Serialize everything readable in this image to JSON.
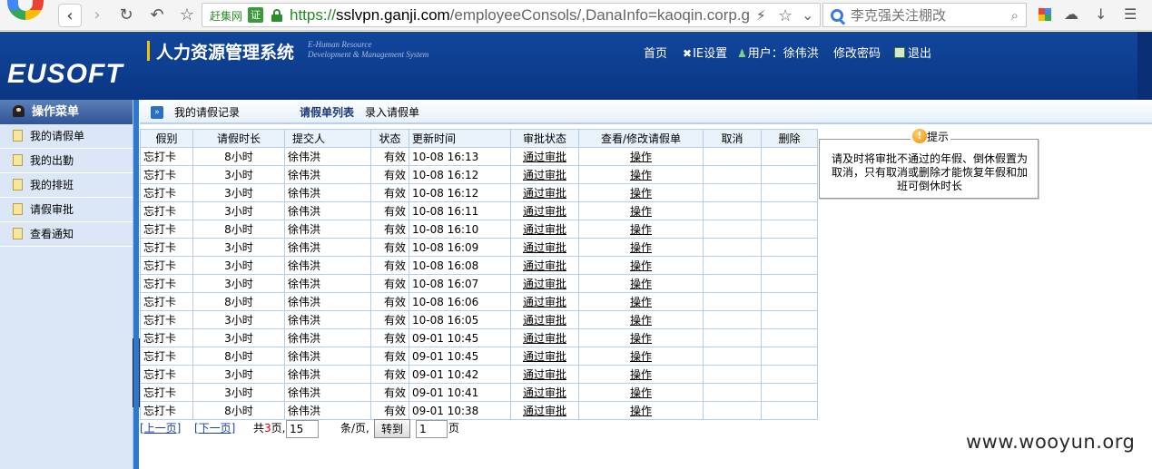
{
  "browser": {
    "site_tag": "赶集网",
    "cert_badge": "证",
    "url_scheme": "https://",
    "url_host": "sslvpn.ganji.com",
    "url_path": "/employeeConsols/,DanaInfo=kaoqin.corp.ga",
    "search_placeholder": "李克强关注棚改"
  },
  "header": {
    "logo": "EUSOFT",
    "title": "人力资源管理系统",
    "subtitle_line1": "E-Human Resource",
    "subtitle_line2": "Development & Management System",
    "nav": {
      "home": "首页",
      "ie_settings": "IE设置",
      "user_label": "用户：徐伟洪",
      "change_password": "修改密码",
      "logout": "退出"
    }
  },
  "sidebar": {
    "title": "操作菜单",
    "items": [
      {
        "label": "我的请假单"
      },
      {
        "label": "我的出勤"
      },
      {
        "label": "我的排班"
      },
      {
        "label": "请假审批"
      },
      {
        "label": "查看通知"
      }
    ]
  },
  "tabs": {
    "records": "我的请假记录",
    "list": "请假单列表",
    "enter": "录入请假单"
  },
  "table": {
    "headers": [
      "假别",
      "请假时长",
      "提交人",
      "状态",
      "更新时间",
      "审批状态",
      "查看/修改请假单",
      "取消",
      "删除"
    ],
    "rows": [
      {
        "type": "忘打卡",
        "duration": "8小时",
        "user": "徐伟洪",
        "state": "有效",
        "time": "10-08 16:13",
        "approval": "通过审批",
        "op": "操作"
      },
      {
        "type": "忘打卡",
        "duration": "3小时",
        "user": "徐伟洪",
        "state": "有效",
        "time": "10-08 16:12",
        "approval": "通过审批",
        "op": "操作"
      },
      {
        "type": "忘打卡",
        "duration": "3小时",
        "user": "徐伟洪",
        "state": "有效",
        "time": "10-08 16:12",
        "approval": "通过审批",
        "op": "操作"
      },
      {
        "type": "忘打卡",
        "duration": "3小时",
        "user": "徐伟洪",
        "state": "有效",
        "time": "10-08 16:11",
        "approval": "通过审批",
        "op": "操作"
      },
      {
        "type": "忘打卡",
        "duration": "8小时",
        "user": "徐伟洪",
        "state": "有效",
        "time": "10-08 16:10",
        "approval": "通过审批",
        "op": "操作"
      },
      {
        "type": "忘打卡",
        "duration": "3小时",
        "user": "徐伟洪",
        "state": "有效",
        "time": "10-08 16:09",
        "approval": "通过审批",
        "op": "操作"
      },
      {
        "type": "忘打卡",
        "duration": "3小时",
        "user": "徐伟洪",
        "state": "有效",
        "time": "10-08 16:08",
        "approval": "通过审批",
        "op": "操作"
      },
      {
        "type": "忘打卡",
        "duration": "3小时",
        "user": "徐伟洪",
        "state": "有效",
        "time": "10-08 16:07",
        "approval": "通过审批",
        "op": "操作"
      },
      {
        "type": "忘打卡",
        "duration": "8小时",
        "user": "徐伟洪",
        "state": "有效",
        "time": "10-08 16:06",
        "approval": "通过审批",
        "op": "操作"
      },
      {
        "type": "忘打卡",
        "duration": "3小时",
        "user": "徐伟洪",
        "state": "有效",
        "time": "10-08 16:05",
        "approval": "通过审批",
        "op": "操作"
      },
      {
        "type": "忘打卡",
        "duration": "3小时",
        "user": "徐伟洪",
        "state": "有效",
        "time": "09-01 10:45",
        "approval": "通过审批",
        "op": "操作"
      },
      {
        "type": "忘打卡",
        "duration": "8小时",
        "user": "徐伟洪",
        "state": "有效",
        "time": "09-01 10:45",
        "approval": "通过审批",
        "op": "操作"
      },
      {
        "type": "忘打卡",
        "duration": "3小时",
        "user": "徐伟洪",
        "state": "有效",
        "time": "09-01 10:42",
        "approval": "通过审批",
        "op": "操作"
      },
      {
        "type": "忘打卡",
        "duration": "3小时",
        "user": "徐伟洪",
        "state": "有效",
        "time": "09-01 10:41",
        "approval": "通过审批",
        "op": "操作"
      },
      {
        "type": "忘打卡",
        "duration": "8小时",
        "user": "徐伟洪",
        "state": "有效",
        "time": "09-01 10:38",
        "approval": "通过审批",
        "op": "操作"
      }
    ]
  },
  "pager": {
    "prev": "[上一页]",
    "next": "[下一页]",
    "total_prefix": "共",
    "total_pages": "3",
    "total_suffix": "页,",
    "page_size": "15",
    "per_page_label": "条/页,",
    "go_button": "转到",
    "page_value": "1",
    "page_label": "页"
  },
  "tip": {
    "title": "提示",
    "text": "请及时将审批不通过的年假、倒休假置为取消，只有取消或删除才能恢复年假和加班可倒休时长"
  },
  "watermark": "www.wooyun.org",
  "colors": {
    "header_blue": "#0d3d8e",
    "sidebar_bg": "#dbe7f7",
    "grid_border": "#b6cde8",
    "accent_yellow": "#f5c400"
  }
}
